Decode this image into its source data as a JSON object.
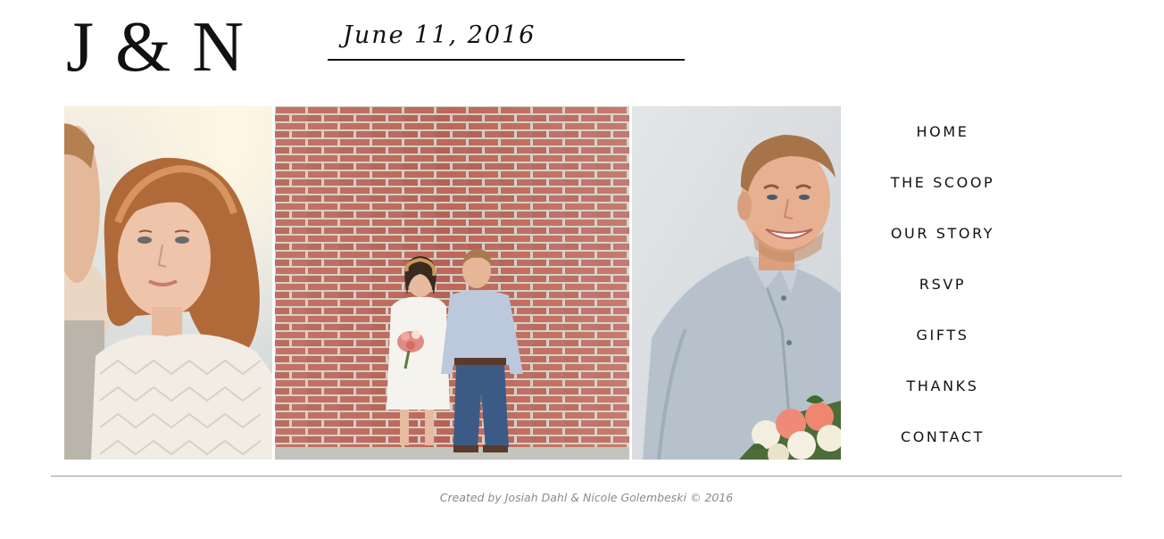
{
  "header": {
    "monogram": "J & N",
    "date": "June 11, 2016"
  },
  "photos": [
    {
      "name": "couple-closeup-photo"
    },
    {
      "name": "couple-brick-wall-photo"
    },
    {
      "name": "groom-bouquet-photo"
    }
  ],
  "nav": {
    "items": [
      {
        "label": "HOME"
      },
      {
        "label": "THE SCOOP"
      },
      {
        "label": "OUR STORY"
      },
      {
        "label": "RSVP"
      },
      {
        "label": "GIFTS"
      },
      {
        "label": "THANKS"
      },
      {
        "label": "CONTACT"
      }
    ]
  },
  "footer": {
    "credit": "Created by Josiah Dahl & Nicole Golembeski © 2016"
  },
  "colors": {
    "text": "#111111",
    "footer_text": "#8a8a8a",
    "rule": "#9a9a9a",
    "brick": "#b5584a",
    "mortar": "#c9c4bc"
  }
}
